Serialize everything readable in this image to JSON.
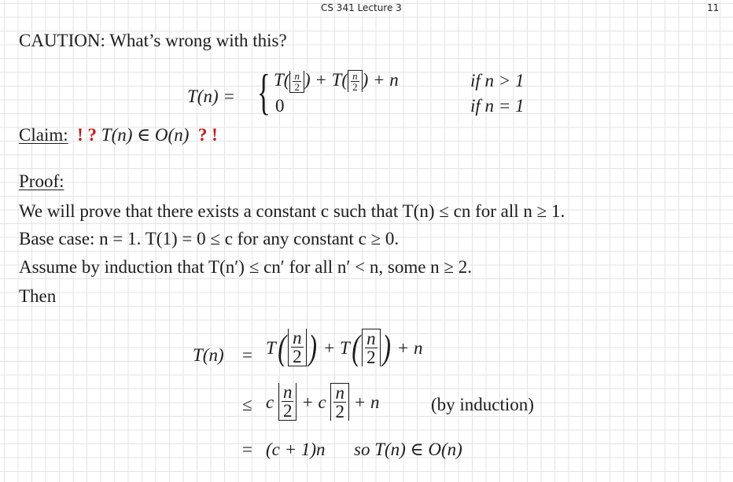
{
  "header": {
    "title": "CS 341 Lecture 3",
    "page_number": "11"
  },
  "caution": {
    "heading": "CAUTION: What’s wrong with this?"
  },
  "recurrence": {
    "lhs": "T(n) =",
    "case1_condition": "if n > 1",
    "case2_value": "0",
    "case2_condition": "if n = 1"
  },
  "claim": {
    "label": "Claim:",
    "marks_open": "! ?",
    "statement": "T(n) ∈ O(n)",
    "marks_close": "? !"
  },
  "proof": {
    "label": "Proof:",
    "line1": "We will prove that there exists a constant c such that T(n) ≤ cn for all n ≥ 1.",
    "line2": "Base case: n = 1. T(1) = 0 ≤ c for any constant c ≥ 0.",
    "line3": "Assume by induction that T(n′) ≤ cn′ for all n′ < n, some n ≥ 2.",
    "line4": "Then"
  },
  "derivation": {
    "row1_lhs": "T(n)",
    "row1_rel": "=",
    "row2_rel": "≤",
    "row2_note": "(by induction)",
    "row3_rel": "=",
    "row3_expr": "(c + 1)n",
    "row3_conclusion": "so T(n) ∈ O(n)"
  }
}
